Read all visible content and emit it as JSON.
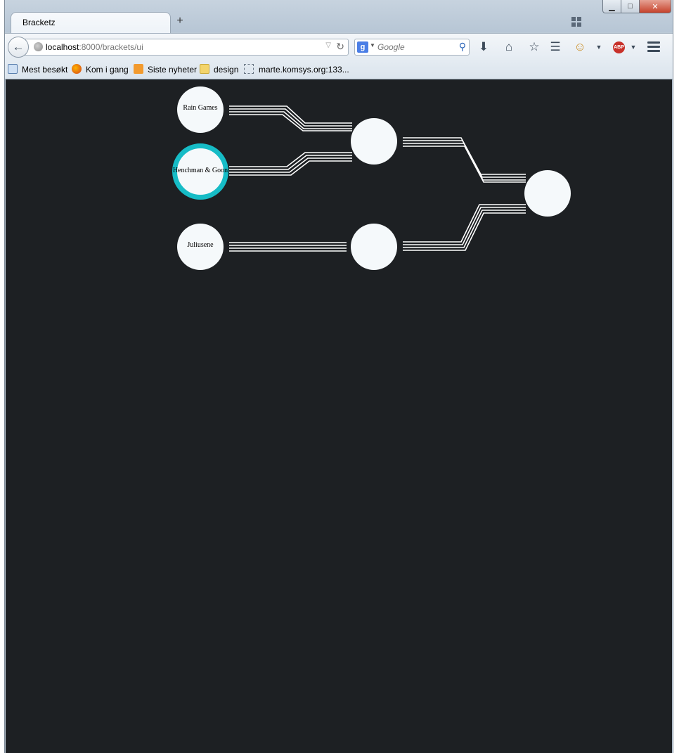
{
  "window": {
    "controls": {
      "minimize": "▁",
      "maximize": "□",
      "close": "✕"
    }
  },
  "tab": {
    "title": "Bracketz",
    "new_tab": "+"
  },
  "navbar": {
    "url_host": "localhost",
    "url_rest": ":8000/brackets/ui",
    "search_engine": "g",
    "search_placeholder": "Google"
  },
  "bookmarks": [
    {
      "label": "Mest besøkt",
      "icon": "bookmark-star-icon"
    },
    {
      "label": "Kom i gang",
      "icon": "firefox-icon"
    },
    {
      "label": "Siste nyheter",
      "icon": "rss-icon"
    },
    {
      "label": "design",
      "icon": "folder-icon"
    },
    {
      "label": "marte.komsys.org:133...",
      "icon": "blank-page-icon"
    }
  ],
  "bracket": {
    "teams": [
      "Rain Games",
      "Henchman & Goon",
      "Juliusene"
    ],
    "selected_team": "Henchman & Goon",
    "colors": {
      "background": "#1d2023",
      "node": "#f5f9fb",
      "selected_ring": "#16bcc6",
      "line": "#ffffff"
    }
  }
}
